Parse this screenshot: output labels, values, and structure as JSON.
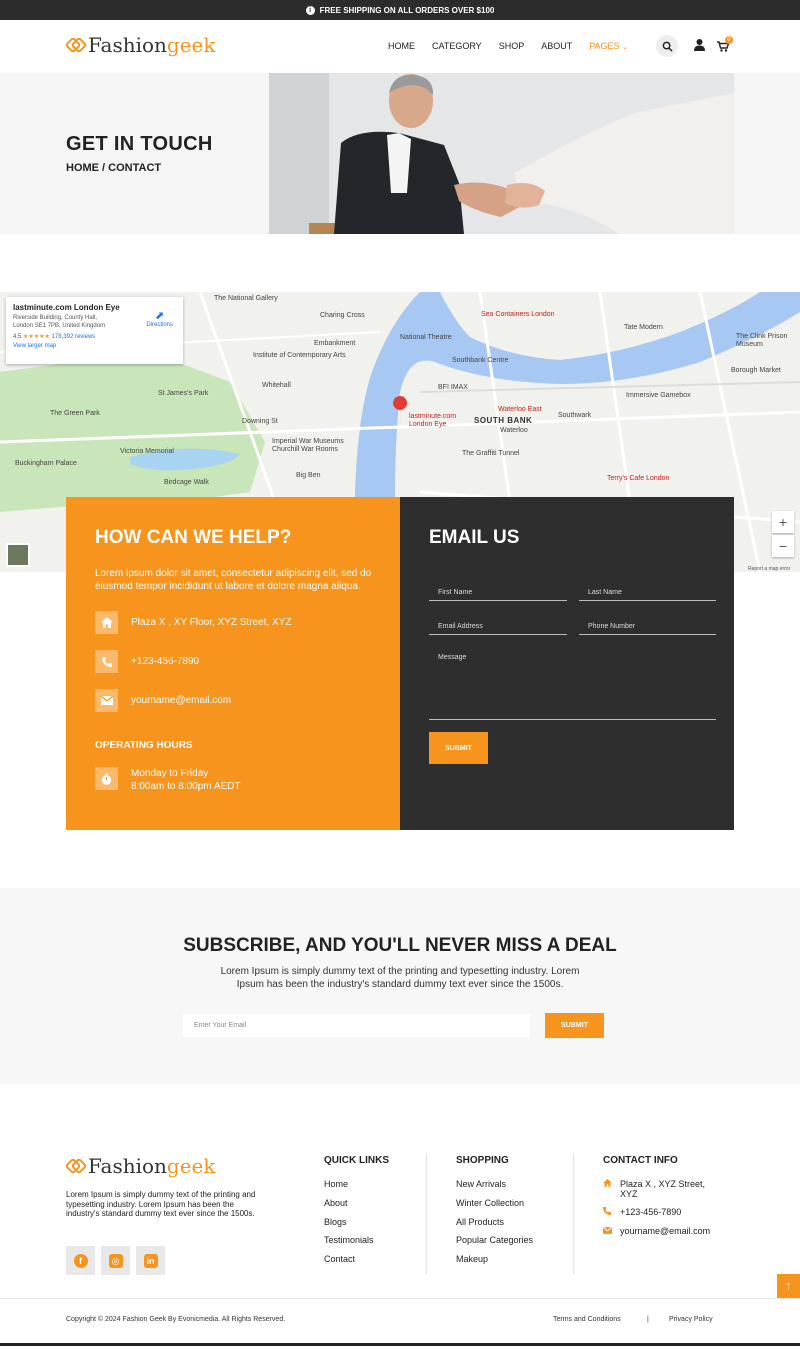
{
  "announcement": {
    "text": "FREE SHIPPING ON ALL ORDERS OVER $100"
  },
  "brand": {
    "part_a": "Fashion",
    "part_b": "geek"
  },
  "nav": {
    "items": [
      "HOME",
      "CATEGORY",
      "SHOP",
      "ABOUT"
    ],
    "active": "PAGES",
    "chevron": "⌄"
  },
  "header": {
    "cart_count": "0"
  },
  "hero": {
    "title": "GET IN TOUCH",
    "breadcrumb": "HOME / CONTACT"
  },
  "map": {
    "place_name": "lastminute.com London Eye",
    "address_1": "Riverside Building, County Hall,",
    "address_2": "London SE1 7PB, United Kingdom",
    "rating": "4.5",
    "stars": "★★★★★",
    "reviews": "178,392 reviews",
    "larger_map": "View larger map",
    "directions": "Directions",
    "pin_label_1": "lastminute.com",
    "pin_label_2": "London Eye",
    "labels": [
      "The National Gallery",
      "Charing Cross",
      "Sea Containers London",
      "Tate Modern",
      "Institute of Contemporary Arts",
      "National Theatre",
      "Southbank Centre",
      "St James's Park",
      "Whitehall",
      "The Green Park",
      "BFI IMAX",
      "SOUTH BANK",
      "Waterloo East",
      "Southwark",
      "Immersive Gamebox",
      "Buckingham Palace",
      "Victoria Memorial",
      "Downing St",
      "Imperial War Museums Churchill War Rooms",
      "The Graffiti Tunnel",
      "Big Ben",
      "Terry's Cafe London",
      "Borough Market",
      "The Clink Prison Museum",
      "Birdcage Walk",
      "Embankment",
      "Waterloo"
    ],
    "terms": "Report a map error"
  },
  "help": {
    "title": "HOW CAN WE HELP?",
    "intro": "Lorem ipsum dolor sit amet, consectetur adipiscing elit, sed do eiusmod tempor incididunt ut labore et dolore magna aliqua.",
    "address": "Plaza X , XY Floor, XYZ Street, XYZ",
    "phone": "+123-456-7890",
    "email": "yourname@email.com",
    "hours_title": "OPERATING HOURS",
    "hours_days": "Monday to Friday",
    "hours_time": "8:00am to 8:00pm AEDT"
  },
  "email_form": {
    "title": "EMAIL US",
    "first_name": "First Name",
    "last_name": "Last Name",
    "email": "Email Address",
    "phone": "Phone Number",
    "message": "Message",
    "submit": "SUBMIT"
  },
  "subscribe": {
    "title": "SUBSCRIBE, AND YOU'LL NEVER MISS A DEAL",
    "text": "Lorem Ipsum is simply dummy text of the printing and typesetting industry. Lorem Ipsum has been the industry's standard dummy text ever since the 1500s.",
    "placeholder": "Enter Your Email",
    "submit": "SUBMIT"
  },
  "footer": {
    "about": "Lorem Ipsum is simply dummy text of the printing and typesetting industry. Lorem Ipsum has been the industry's standard dummy text ever since the 1500s.",
    "quick_links_title": "QUICK LINKS",
    "quick_links": [
      "Home",
      "About",
      "Blogs",
      "Testimonials",
      "Contact"
    ],
    "shopping_title": "SHOPPING",
    "shopping": [
      "New Arrivals",
      "Winter Collection",
      "All Products",
      "Popular Categories",
      "Makeup"
    ],
    "contact_title": "CONTACT INFO",
    "contact_address": "Plaza X , XYZ Street, XYZ",
    "contact_phone": "+123-456-7890",
    "contact_email": "yourname@email.com",
    "copyright": "Copyright © 2024 Fashion Geek By Evonicmedia. All Rights Reserved.",
    "terms": "Terms and Conditions",
    "separator": "|",
    "privacy": "Privacy Policy"
  },
  "colors": {
    "accent": "#f7941d",
    "dark": "#2e2e2e",
    "topbar": "#2c2c2c"
  }
}
